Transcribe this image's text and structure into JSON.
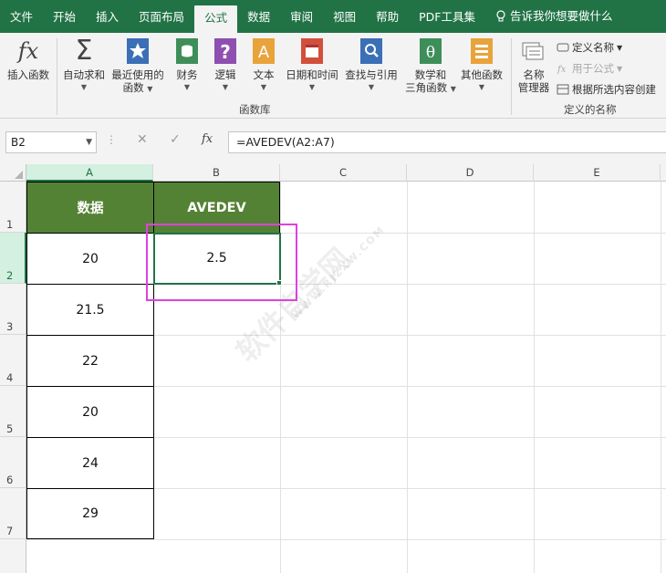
{
  "menu": {
    "tabs": [
      "文件",
      "开始",
      "插入",
      "页面布局",
      "公式",
      "数据",
      "审阅",
      "视图",
      "帮助",
      "PDF工具集"
    ],
    "active_tab": "公式",
    "tell_me": "告诉我你想要做什么"
  },
  "ribbon": {
    "function_library": {
      "insert_function": "插入函数",
      "autosum": "自动求和",
      "recently_used": [
        "最近使用的",
        "函数"
      ],
      "financial": "财务",
      "logical": "逻辑",
      "text": "文本",
      "datetime": "日期和时间",
      "lookup": "查找与引用",
      "math_trig": [
        "数学和",
        "三角函数"
      ],
      "more": "其他函数",
      "group_label": "函数库"
    },
    "defined_names": {
      "name_manager": [
        "名称",
        "管理器"
      ],
      "define_name": "定义名称",
      "use_in_formula": "用于公式",
      "create_from_selection": "根据所选内容创建",
      "group_label": "定义的名称"
    }
  },
  "formula_bar": {
    "name_box": "B2",
    "cancel": "✕",
    "enter": "✓",
    "fx": "fx",
    "formula": "=AVEDEV(A2:A7)"
  },
  "sheet": {
    "columns": [
      "A",
      "B",
      "C",
      "D",
      "E"
    ],
    "rows": [
      "1",
      "2",
      "3",
      "4",
      "5",
      "6",
      "7"
    ],
    "header_a": "数据",
    "header_b": "AVEDEV",
    "data_a": [
      "20",
      "21.5",
      "22",
      "20",
      "24",
      "29"
    ],
    "result_b2": "2.5"
  },
  "watermark": {
    "main": "软件自学网",
    "sub": "WWW.RJZXW.COM"
  },
  "colors": {
    "excel_green": "#217346",
    "header_fill": "#548235",
    "highlight": "#e040e0"
  }
}
